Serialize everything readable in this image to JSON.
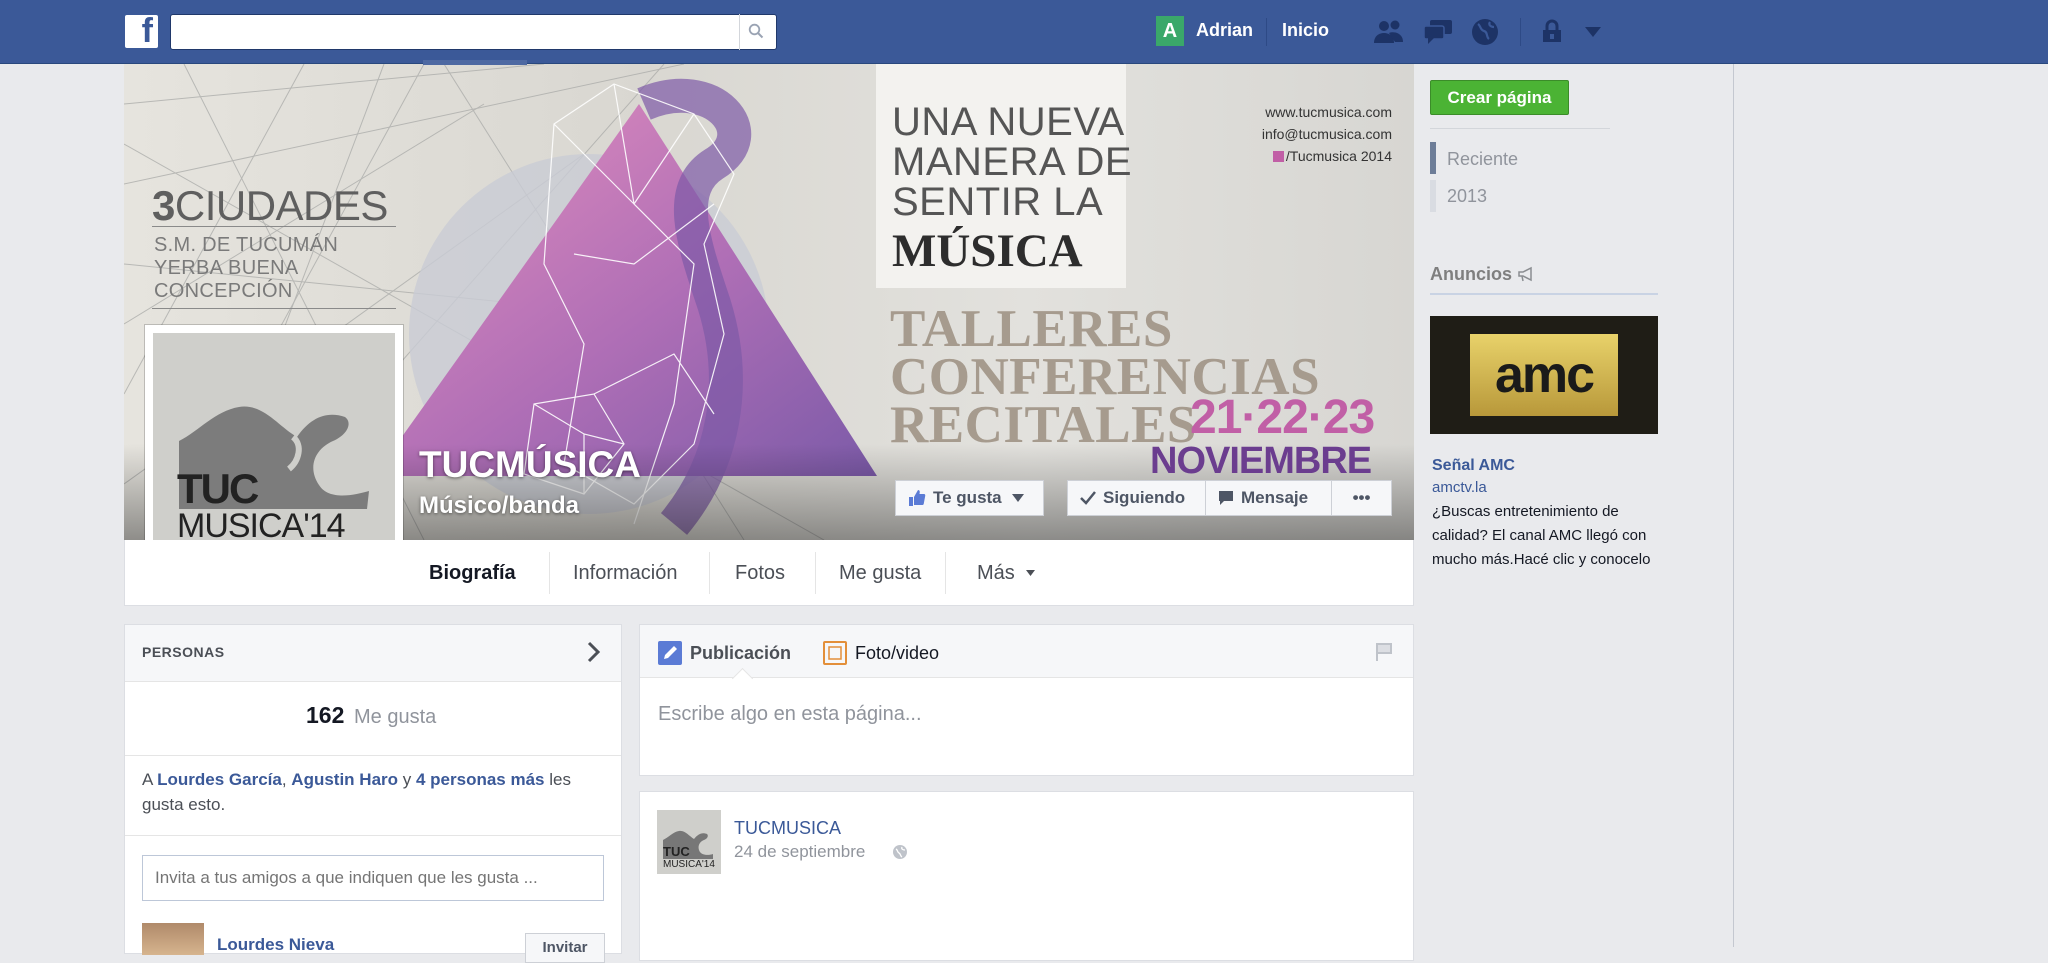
{
  "topbar": {
    "logo_letter": "f",
    "search_placeholder": "",
    "user_initial": "A",
    "user_name": "Adrian",
    "home_label": "Inicio"
  },
  "cover": {
    "cities_number": "3",
    "cities_word": "CIUDADES",
    "cities": [
      "S.M. DE TUCUMÁN",
      "YERBA BUENA",
      "CONCEPCIÓN"
    ],
    "headline": [
      "UNA NUEVA",
      "MANERA DE",
      "SENTIR LA",
      "MÚSICA"
    ],
    "contact": [
      "www.tucmusica.com",
      "info@tucmusica.com",
      "/Tucmusica 2014"
    ],
    "events": [
      "TALLERES",
      "CONFERENCIAS",
      "RECITALES"
    ],
    "dates": "21·22·23",
    "month": "NOVIEMBRE",
    "page_name": "TUCMÚSICA",
    "page_category": "Músico/banda",
    "logo_line1": "TUC",
    "logo_line2": "MUSICA'14"
  },
  "actions": {
    "like": "Te gusta",
    "following": "Siguiendo",
    "message": "Mensaje",
    "more": "•••"
  },
  "tabs": [
    "Biografía",
    "Información",
    "Fotos",
    "Me gusta",
    "Más"
  ],
  "people": {
    "title": "PERSONAS",
    "likes_count": "162",
    "likes_label": "Me gusta",
    "friends_prefix": "A ",
    "friend1": "Lourdes García",
    "friend2": "Agustin Haro",
    "friends_mid": " y ",
    "friends_more": "4 personas más",
    "friends_suffix": " les gusta esto.",
    "invite_placeholder": "Invita a tus amigos a que indiquen que les gusta ...",
    "friend_row_name": "Lourdes Nieva",
    "invite_button": "Invitar"
  },
  "composer": {
    "tab_post": "Publicación",
    "tab_photo": "Foto/video",
    "placeholder": "Escribe algo en esta página..."
  },
  "post": {
    "author": "TUCMUSICA",
    "date": "24 de septiembre"
  },
  "right": {
    "create_page": "Crear página",
    "years": [
      "Reciente",
      "2013"
    ],
    "ads_title": "Anuncios",
    "ad_logo": "amc",
    "ad_title": "Señal AMC",
    "ad_url": "amctv.la",
    "ad_body": "¿Buscas entretenimiento de calidad? El canal AMC llegó con mucho más.Hacé clic y conocelo"
  },
  "colors": {
    "brand": "#3b5998",
    "create_green": "#4bb334",
    "date_pink": "#c15fa6",
    "month_purple": "#6b3d8f"
  }
}
